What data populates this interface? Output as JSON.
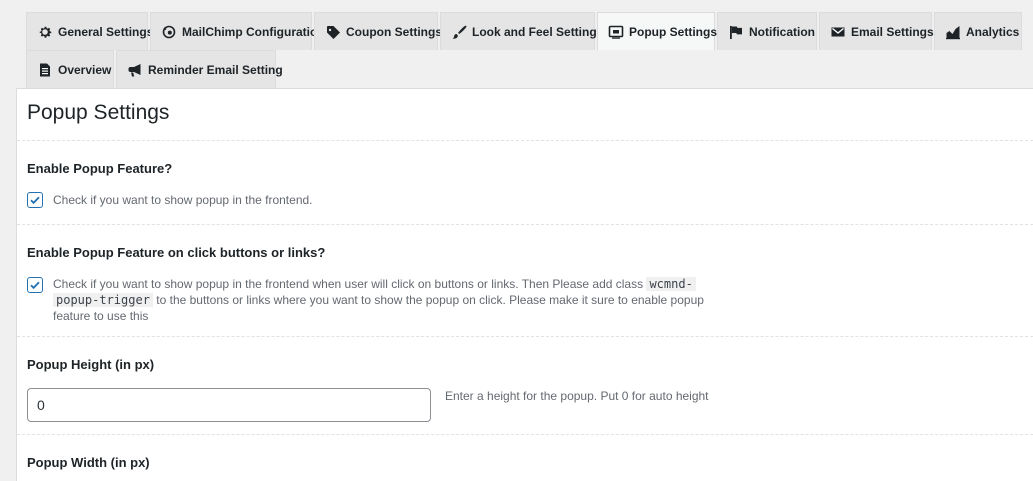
{
  "tabs": [
    {
      "label": "General Settings",
      "icon": "gear-icon"
    },
    {
      "label": "MailChimp Configuration",
      "icon": "mailchimp-icon"
    },
    {
      "label": "Coupon Settings",
      "icon": "tag-icon"
    },
    {
      "label": "Look and Feel Settings",
      "icon": "brush-icon"
    },
    {
      "label": "Popup Settings",
      "icon": "popup-icon",
      "active": true
    },
    {
      "label": "Notification",
      "icon": "flag-icon"
    },
    {
      "label": "Email Settings",
      "icon": "envelope-icon"
    },
    {
      "label": "Analytics",
      "icon": "chart-icon"
    },
    {
      "label": "Overview",
      "icon": "document-icon"
    },
    {
      "label": "Reminder Email Setting",
      "icon": "megaphone-icon"
    }
  ],
  "page": {
    "title": "Popup Settings"
  },
  "settings": {
    "enable_popup": {
      "label": "Enable Popup Feature?",
      "checked": true,
      "description": "Check if you want to show popup in the frontend."
    },
    "enable_click": {
      "label": "Enable Popup Feature on click buttons or links?",
      "checked": true,
      "description_1": "Check if you want to show popup in the frontend when user will click on buttons or links. Then Please add class",
      "code_1": "wcmnd-",
      "code_2": "popup-trigger",
      "description_2": "to the buttons or links where you want to show the popup on click. Please make it sure to enable popup feature to use this"
    },
    "popup_height": {
      "label": "Popup Height (in px)",
      "value": "0",
      "description": "Enter a height for the popup. Put 0 for auto height"
    },
    "popup_width": {
      "label": "Popup Width (in px)"
    }
  },
  "colors": {
    "accent": "#2271b1",
    "tab_bg": "#e5e5e5",
    "page_bg": "#f0f0f1"
  }
}
